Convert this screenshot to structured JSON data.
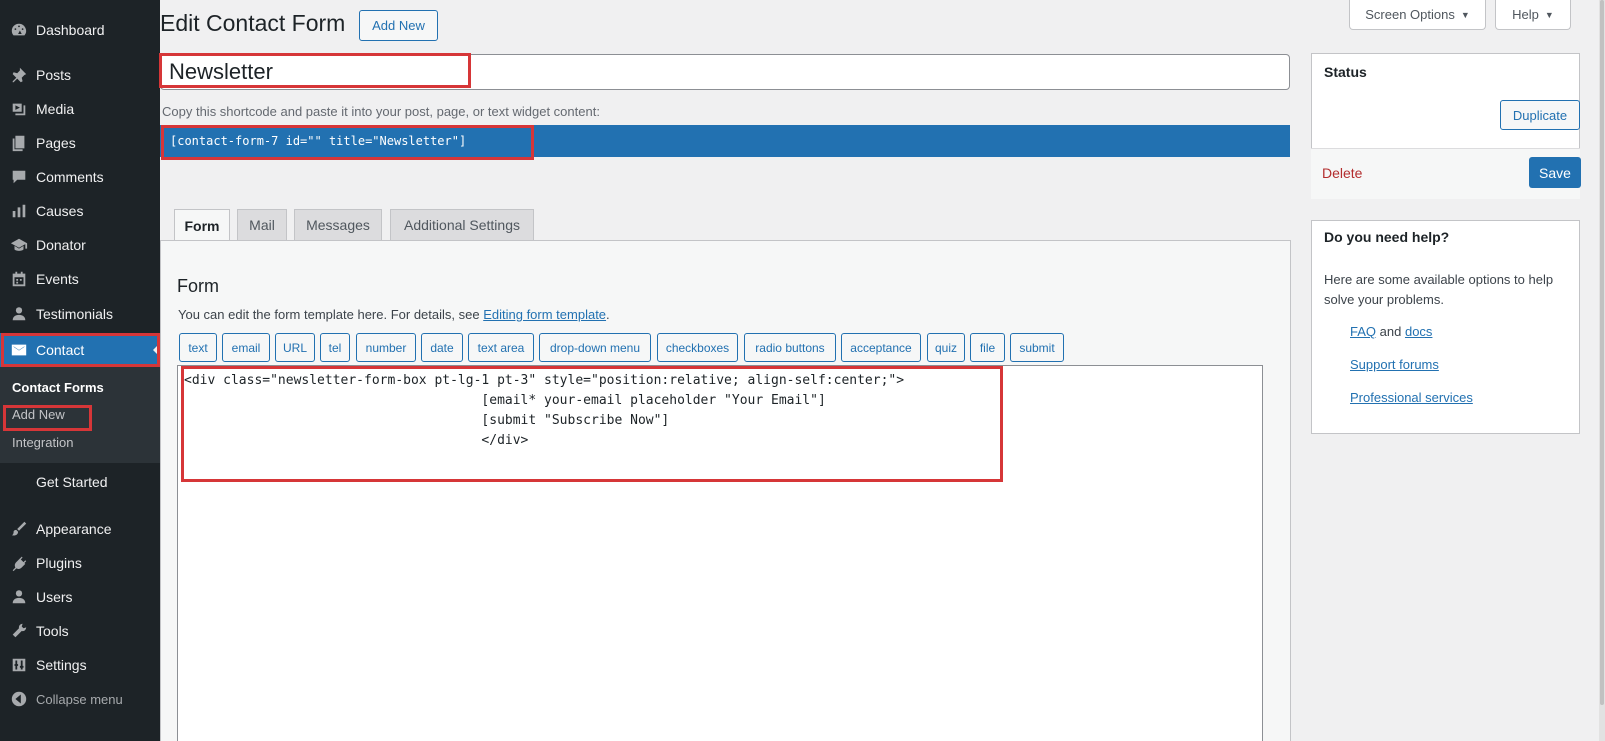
{
  "sidebar": {
    "items": [
      {
        "label": "Dashboard",
        "icon": "dashboard-icon"
      },
      {
        "label": "Posts",
        "icon": "pin-icon"
      },
      {
        "label": "Media",
        "icon": "media-icon"
      },
      {
        "label": "Pages",
        "icon": "pages-icon"
      },
      {
        "label": "Comments",
        "icon": "comment-icon"
      },
      {
        "label": "Causes",
        "icon": "bar-chart-icon"
      },
      {
        "label": "Donator",
        "icon": "graduation-cap-icon"
      },
      {
        "label": "Events",
        "icon": "calendar-icon"
      },
      {
        "label": "Testimonials",
        "icon": "user-icon"
      },
      {
        "label": "Contact",
        "icon": "envelope-icon"
      },
      {
        "label": "Get Started",
        "icon": ""
      },
      {
        "label": "Appearance",
        "icon": "paintbrush-icon"
      },
      {
        "label": "Plugins",
        "icon": "plug-icon"
      },
      {
        "label": "Users",
        "icon": "user-icon"
      },
      {
        "label": "Tools",
        "icon": "wrench-icon"
      },
      {
        "label": "Settings",
        "icon": "settings-icon"
      },
      {
        "label": "Collapse menu",
        "icon": "collapse-icon"
      }
    ],
    "submenu": [
      "Contact Forms",
      "Add New",
      "Integration"
    ]
  },
  "header": {
    "title": "Edit Contact Form",
    "add_new": "Add New",
    "screen_options": "Screen Options",
    "help": "Help"
  },
  "form": {
    "title_value": "Newsletter",
    "shortcode_label": "Copy this shortcode and paste it into your post, page, or text widget content:",
    "shortcode": "[contact-form-7 id=\"\" title=\"Newsletter\"]",
    "tabs": [
      "Form",
      "Mail",
      "Messages",
      "Additional Settings"
    ],
    "panel_title": "Form",
    "desc_prefix": "You can edit the form template here. For details, see ",
    "desc_link": "Editing form template",
    "desc_suffix": ".",
    "tag_buttons": [
      "text",
      "email",
      "URL",
      "tel",
      "number",
      "date",
      "text area",
      "drop-down menu",
      "checkboxes",
      "radio buttons",
      "acceptance",
      "quiz",
      "file",
      "submit"
    ],
    "code_lines": [
      "<div class=\"newsletter-form-box pt-lg-1 pt-3\" style=\"position:relative; align-self:center;\">",
      "                                      [email* your-email placeholder \"Your Email\"]",
      "                                      [submit \"Subscribe Now\"]",
      "                                      </div>"
    ]
  },
  "status": {
    "title": "Status",
    "duplicate": "Duplicate",
    "delete": "Delete",
    "save": "Save"
  },
  "help": {
    "title": "Do you need help?",
    "text": "Here are some available options to help solve your problems.",
    "faq": "FAQ",
    "and": "and",
    "docs": "docs",
    "support": "Support forums",
    "professional": "Professional services"
  },
  "colors": {
    "accent": "#2271b1",
    "sidebar_bg": "#1d2327",
    "highlight_border": "#d63638",
    "delete": "#b32d2e"
  }
}
